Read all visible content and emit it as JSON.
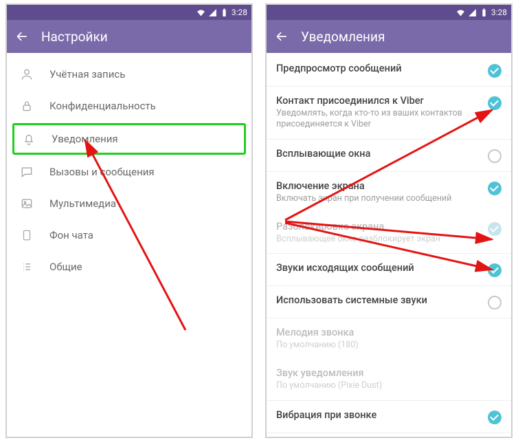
{
  "status": {
    "time": "3:28"
  },
  "left": {
    "title": "Настройки",
    "items": [
      {
        "label": "Учётная запись"
      },
      {
        "label": "Конфиденциальность"
      },
      {
        "label": "Уведомления"
      },
      {
        "label": "Вызовы и сообщения"
      },
      {
        "label": "Мультимедиа"
      },
      {
        "label": "Фон чата"
      },
      {
        "label": "Общие"
      }
    ]
  },
  "right": {
    "title": "Уведомления",
    "rows": [
      {
        "title": "Предпросмотр сообщений",
        "checked": "on"
      },
      {
        "title": "Контакт присоединился к Viber",
        "sub": "Уведомлять, когда кто-то из ваших контактов присоединяется к Viber",
        "checked": "on"
      },
      {
        "title": "Всплывающие окна",
        "checked": "off"
      },
      {
        "title": "Включение экрана",
        "sub": "Включать экран при получении сообщений",
        "checked": "on"
      },
      {
        "title": "Разблокировка экрана",
        "sub": "Всплывающее окно разблокирует экран",
        "checked": "on-disabled"
      },
      {
        "title": "Звуки исходящих сообщений",
        "checked": "on"
      },
      {
        "title": "Использовать системные звуки",
        "checked": "off"
      },
      {
        "title": "Мелодия звонка",
        "sub": "По умолчанию (180)"
      },
      {
        "title": "Звук уведомления",
        "sub": "По умолчанию (Pixie Dust)"
      },
      {
        "title": "Вибрация при звонке",
        "checked": "on"
      }
    ]
  }
}
